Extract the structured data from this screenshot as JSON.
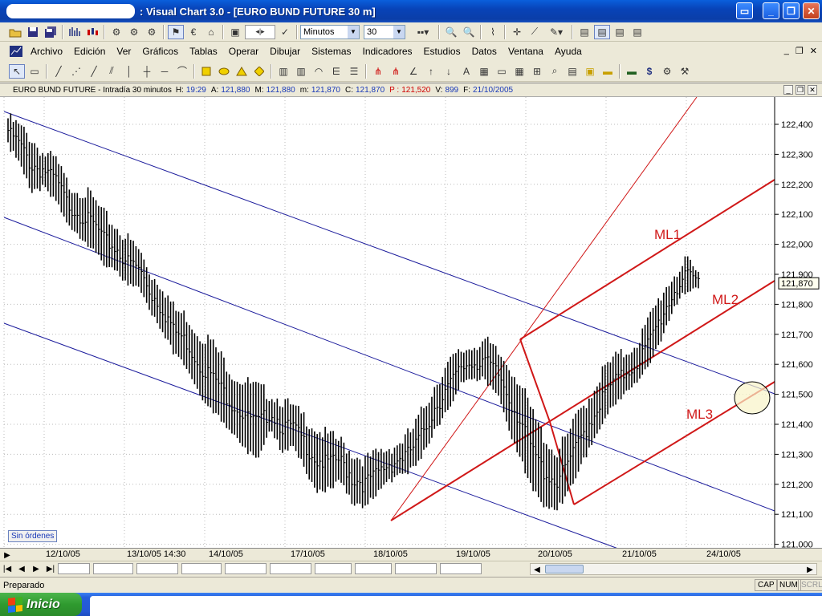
{
  "window": {
    "title": ": Visual Chart  3.0 - [EURO BUND FUTURE 30 m]"
  },
  "toolbar1": {
    "timeframe_value": "Minutos",
    "interval_value": "30"
  },
  "menu": {
    "items": [
      "Archivo",
      "Edición",
      "Ver",
      "Gráficos",
      "Tablas",
      "Operar",
      "Dibujar",
      "Sistemas",
      "Indicadores",
      "Estudios",
      "Datos",
      "Ventana",
      "Ayuda"
    ]
  },
  "info": {
    "instrument": "EURO BUND FUTURE - Intradía 30 minutos",
    "h_label": "H:",
    "h_value": "19:29",
    "a_label": "A:",
    "a_value": "121,880",
    "m_label": "M:",
    "m_value": "121,880",
    "mm_label": "m:",
    "mm_value": "121,870",
    "c_label": "C:",
    "c_value": "121,870",
    "p_label": "P :",
    "p_value": "121,520",
    "v_label": "V:",
    "v_value": "899",
    "f_label": "F:",
    "f_value": "21/10/2005"
  },
  "chart_data": {
    "type": "bar",
    "instrument": "EURO BUND FUTURE",
    "timeframe": "30 minutos",
    "y_axis_labels": [
      "122,400",
      "122,300",
      "122,200",
      "122,100",
      "122,000",
      "121,900",
      "121,800",
      "121,700",
      "121,600",
      "121,500",
      "121,400",
      "121,300",
      "121,200",
      "121,100",
      "121,000"
    ],
    "ylim": [
      121000,
      122400
    ],
    "last_price_label": "121,870",
    "x_axis_labels": [
      "12/10/05",
      "13/10/05 14:30",
      "14/10/05",
      "17/10/05",
      "18/10/05",
      "19/10/05",
      "20/10/05",
      "21/10/05",
      "24/10/05"
    ],
    "annotations": [
      "ML1",
      "ML2",
      "ML3"
    ],
    "colors": {
      "bars": "#000000",
      "blue_channel": "#1c1c9c",
      "red_lines": "#d01818",
      "ellipse_fill": "#f8f4c8"
    },
    "grid": true,
    "price_path": [
      [
        122420,
        122340
      ],
      [
        122390,
        122280
      ],
      [
        122350,
        122180
      ],
      [
        122300,
        122200
      ],
      [
        122280,
        122160
      ],
      [
        122200,
        122080
      ],
      [
        122180,
        122040
      ],
      [
        122160,
        122000
      ],
      [
        122100,
        121950
      ],
      [
        122060,
        121920
      ],
      [
        122020,
        121880
      ],
      [
        121980,
        121860
      ],
      [
        121900,
        121780
      ],
      [
        121860,
        121720
      ],
      [
        121780,
        121640
      ],
      [
        121760,
        121600
      ],
      [
        121700,
        121520
      ],
      [
        121680,
        121460
      ],
      [
        121620,
        121420
      ],
      [
        121560,
        121380
      ],
      [
        121540,
        121320
      ],
      [
        121520,
        121300
      ],
      [
        121500,
        121400
      ],
      [
        121480,
        121320
      ],
      [
        121450,
        121340
      ],
      [
        121420,
        121260
      ],
      [
        121380,
        121180
      ],
      [
        121360,
        121200
      ],
      [
        121340,
        121220
      ],
      [
        121300,
        121140
      ],
      [
        121280,
        121140
      ],
      [
        121300,
        121180
      ],
      [
        121320,
        121220
      ],
      [
        121340,
        121240
      ],
      [
        121380,
        121260
      ],
      [
        121460,
        121320
      ],
      [
        121540,
        121400
      ],
      [
        121600,
        121460
      ],
      [
        121640,
        121540
      ],
      [
        121660,
        121560
      ],
      [
        121680,
        121560
      ],
      [
        121640,
        121520
      ],
      [
        121600,
        121400
      ],
      [
        121540,
        121300
      ],
      [
        121440,
        121200
      ],
      [
        121360,
        121140
      ],
      [
        121300,
        121120
      ],
      [
        121360,
        121180
      ],
      [
        121440,
        121260
      ],
      [
        121500,
        121340
      ],
      [
        121580,
        121420
      ],
      [
        121620,
        121480
      ],
      [
        121640,
        121520
      ],
      [
        121680,
        121560
      ],
      [
        121760,
        121620
      ],
      [
        121840,
        121700
      ],
      [
        121900,
        121800
      ],
      [
        121940,
        121860
      ],
      [
        121900,
        121860
      ]
    ]
  },
  "orders": {
    "label": "Sin órdenes"
  },
  "status": {
    "text": "Preparado",
    "cap": "CAP",
    "num": "NUM",
    "scrl": "SCRL"
  },
  "taskbar": {
    "start_label": "Inicio"
  }
}
